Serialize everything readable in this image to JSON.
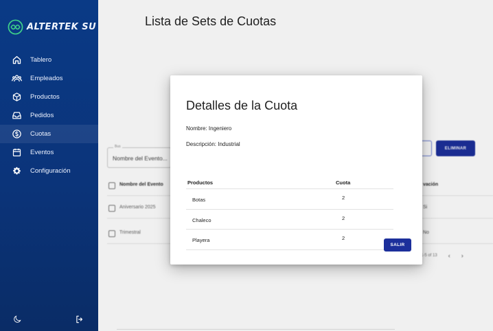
{
  "app": {
    "logo_text": "ALTERTEK SU",
    "page_title": "Lista de Sets de Cuotas"
  },
  "sidebar": {
    "items": [
      {
        "label": "Tablero",
        "icon": "home-icon"
      },
      {
        "label": "Empleados",
        "icon": "users-icon"
      },
      {
        "label": "Productos",
        "icon": "box-icon"
      },
      {
        "label": "Pedidos",
        "icon": "inbox-icon"
      },
      {
        "label": "Cuotas",
        "icon": "money-icon",
        "active": true
      },
      {
        "label": "Eventos",
        "icon": "calendar-icon"
      },
      {
        "label": "Configuración",
        "icon": "gear-icon"
      }
    ],
    "footer_icons": [
      "moon-icon",
      "logout-icon"
    ]
  },
  "background": {
    "search_legend": "Bus",
    "search_placeholder": "Nombre del Evento...",
    "delete_label": "ELIMINAR",
    "table_header": "Nombre del Evento",
    "table_header_right": "vación",
    "rows": [
      {
        "name": "Aniversario 2025",
        "right": "Si"
      },
      {
        "name": "Trimestral",
        "right": "No"
      }
    ],
    "pager_text": "1-5 of 13",
    "pager_prev": "‹",
    "pager_next": "›"
  },
  "modal": {
    "title": "Detalles de la Cuota",
    "name_line": "Nombre: Ingeniero",
    "desc_line": "Descripción: Industrial",
    "col_products": "Productos",
    "col_quota": "Cuota",
    "items": [
      {
        "product": "Botas",
        "quota": "2"
      },
      {
        "product": "Chaleco",
        "quota": "2"
      },
      {
        "product": "Playera",
        "quota": "2"
      }
    ],
    "close_label": "SALIR"
  },
  "colors": {
    "sidebar": "#0a3a86",
    "primary_button": "#1c2f9b",
    "logo_green": "#3fd18a"
  }
}
